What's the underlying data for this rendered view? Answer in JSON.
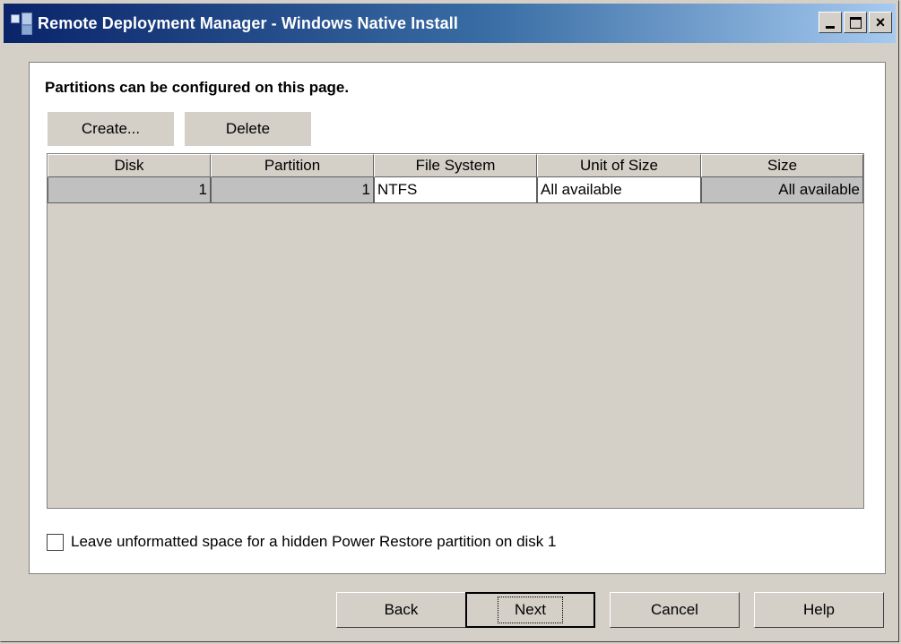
{
  "window": {
    "title": "Remote Deployment Manager - Windows Native Install",
    "controls": {
      "minimize": "_",
      "maximize": "□",
      "close": "×"
    }
  },
  "page": {
    "heading": "Partitions can be configured on this page.",
    "buttons": {
      "create": "Create...",
      "delete": "Delete"
    }
  },
  "table": {
    "columns": [
      "Disk",
      "Partition",
      "File System",
      "Unit of Size",
      "Size"
    ],
    "rows": [
      [
        "1",
        "1",
        "NTFS",
        "All available",
        "All available"
      ]
    ]
  },
  "option": {
    "checked": false,
    "label": "Leave unformatted space for a hidden Power Restore partition on disk 1"
  },
  "footer": {
    "back": "Back",
    "next": "Next",
    "cancel": "Cancel",
    "help": "Help"
  },
  "colors": {
    "title_bar_start": "#0a246a",
    "title_bar_end": "#a6caf0",
    "dialog_background": "#d4d0c8",
    "content_background": "#ffffff",
    "readonly_cell": "#c0c0c0"
  }
}
